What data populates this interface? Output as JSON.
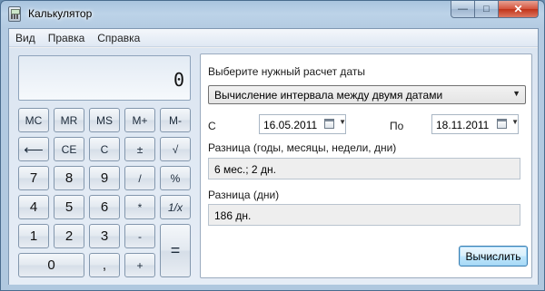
{
  "window": {
    "title": "Калькулятор",
    "close_glyph": "✕",
    "min_glyph": "—",
    "max_glyph": "□"
  },
  "menu": [
    "Вид",
    "Правка",
    "Справка"
  ],
  "display": {
    "value": "0"
  },
  "keys": {
    "mc": "MC",
    "mr": "MR",
    "ms": "MS",
    "mplus": "M+",
    "mminus": "M-",
    "back": "⟵",
    "ce": "CE",
    "c": "C",
    "plusminus": "±",
    "sqrt": "√",
    "n7": "7",
    "n8": "8",
    "n9": "9",
    "div": "/",
    "pct": "%",
    "n4": "4",
    "n5": "5",
    "n6": "6",
    "mul": "*",
    "recip": "1/x",
    "n1": "1",
    "n2": "2",
    "n3": "3",
    "minus": "-",
    "equals": "=",
    "n0": "0",
    "dot": ",",
    "plus": "+"
  },
  "date_panel": {
    "select_label": "Выберите нужный расчет даты",
    "mode": "Вычисление интервала между двумя датами",
    "from_label": "С",
    "from_date": "16.05.2011",
    "to_label": "По",
    "to_date": "18.11.2011",
    "diff_label": "Разница (годы, месяцы, недели, дни)",
    "diff_value": "6 мес.; 2 дн.",
    "days_label": "Разница (дни)",
    "days_value": "186 дн.",
    "calc_button": "Вычислить"
  }
}
